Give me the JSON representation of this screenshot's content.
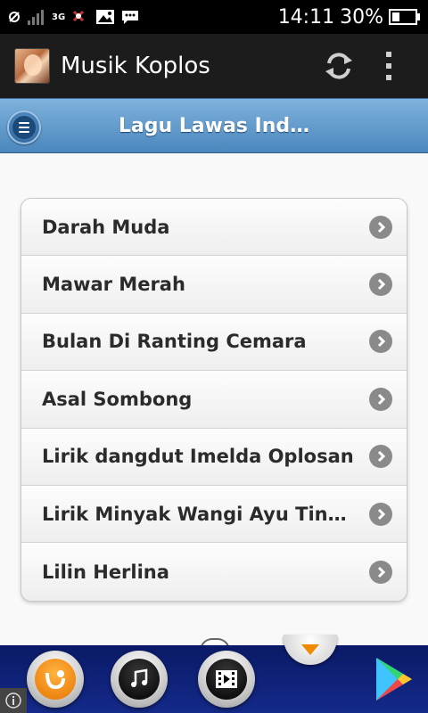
{
  "status_bar": {
    "network_label": "3G",
    "time": "14:11",
    "battery": "30%",
    "icons": [
      "usb-icon",
      "signal-icon",
      "network-3g-icon",
      "bbm-icon",
      "image-icon",
      "chat-icon",
      "alarm-icon",
      "battery-icon"
    ]
  },
  "app_bar": {
    "title": "Musik Koplos",
    "icons": [
      "app-logo-icon",
      "refresh-icon",
      "overflow-menu-icon"
    ]
  },
  "header": {
    "title": "Lagu Lawas Ind…",
    "menu_icon": "menu-icon"
  },
  "list": {
    "items": [
      {
        "label": "Darah Muda"
      },
      {
        "label": "Mawar Merah"
      },
      {
        "label": "Bulan Di Ranting Cemara"
      },
      {
        "label": "Asal Sombong"
      },
      {
        "label": "Lirik dangdut Imelda Oplosan"
      },
      {
        "label": "Lirik Minyak Wangi Ayu Ting Ti…"
      },
      {
        "label": "Lilin Herlina"
      }
    ],
    "item_icon": "chevron-right-icon"
  },
  "dock": {
    "buttons": [
      "uc-browser-icon",
      "music-icon",
      "video-icon"
    ],
    "store_icon": "play-store-icon",
    "pull_icon": "chevron-down-icon",
    "info_icon": "info-icon"
  },
  "colors": {
    "header_blue": "#4a87bd",
    "dock_blue": "#0a1a66",
    "list_text": "#2b2b2b"
  }
}
